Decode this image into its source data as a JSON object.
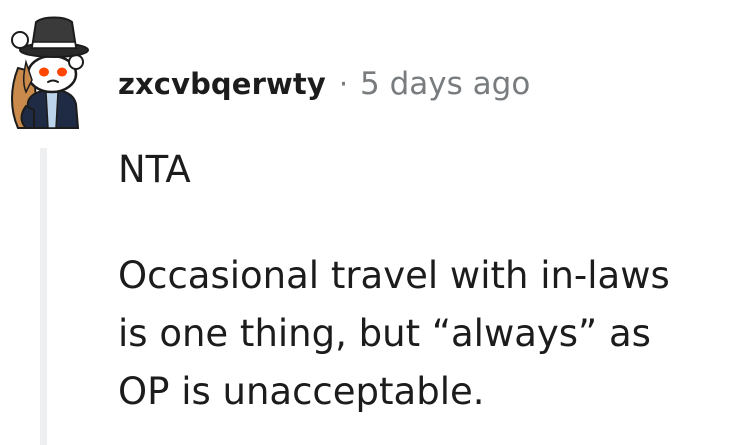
{
  "comment": {
    "author": "zxcvbqerwty",
    "separator": "·",
    "timestamp": "5 days ago",
    "avatar_icon": "snoo-avatar-icon",
    "body": {
      "paragraph1": "NTA",
      "paragraph2_line1": "Occasional travel with in-laws",
      "paragraph2_line2": "is one thing, but “always” as",
      "paragraph2_line3": "OP is unacceptable."
    }
  },
  "colors": {
    "text": "#1c1c1c",
    "meta": "#787c7e",
    "thread_line": "#edeff1",
    "avatar_eyes": "#ff4500",
    "avatar_hair": "#c98a4b",
    "avatar_jacket": "#1f2a44"
  }
}
